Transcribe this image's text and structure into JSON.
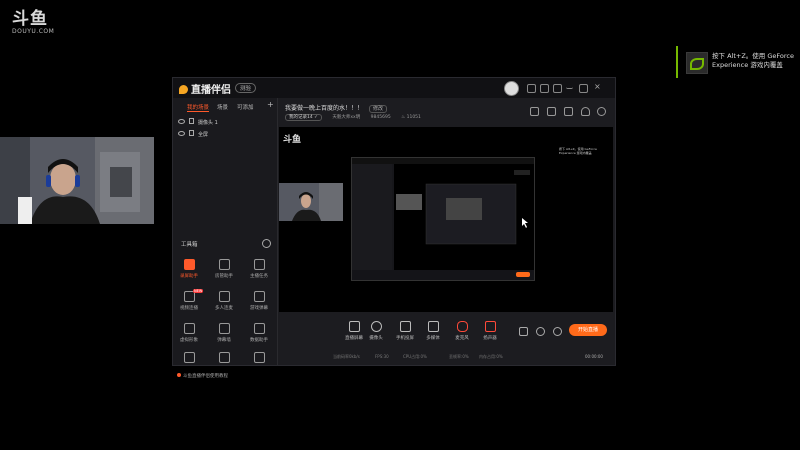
{
  "watermark": {
    "logo": "斗鱼",
    "url": "DOUYU.COM"
  },
  "nvidia_toast": {
    "line1": "按下 Alt+Z。使用 GeForce",
    "line2": "Experience 游戏内覆盖",
    "icon": "nvidia-icon"
  },
  "app": {
    "brand": "直播伴侣",
    "version_badge": "测验",
    "scene_tabs": [
      "我的场景",
      "场景",
      "可添加"
    ],
    "sources": [
      "摄像头 1",
      "全屏"
    ],
    "stream_title": "我要做一晚上百度的水！！！",
    "edit_label": "修改",
    "meta": {
      "category": "我的记录14 ✓",
      "name": "天魁大师xx明",
      "room": "9845695",
      "fans": "11051"
    },
    "toolbox_title": "工具箱",
    "tools": [
      {
        "label": "录屏助手",
        "hot": true,
        "badge": ""
      },
      {
        "label": "房管助手",
        "hot": false,
        "badge": ""
      },
      {
        "label": "主播任务",
        "hot": false,
        "badge": ""
      },
      {
        "label": "视频连播",
        "hot": false,
        "badge": "NEW"
      },
      {
        "label": "多人连麦",
        "hot": false,
        "badge": ""
      },
      {
        "label": "游戏弹幕",
        "hot": false,
        "badge": ""
      },
      {
        "label": "虚拟形象",
        "hot": false,
        "badge": ""
      },
      {
        "label": "弹幕墙",
        "hot": false,
        "badge": ""
      },
      {
        "label": "数据助手",
        "hot": false,
        "badge": ""
      }
    ],
    "tip": "斗鱼直播伴侣使用教程",
    "controls": [
      "直播屏幕",
      "摄像头",
      "手机投屏",
      "多媒体",
      "麦克风",
      "扬声器"
    ],
    "start_button": "开始直播",
    "status": [
      "当前码率0kb/s",
      "FPS:30",
      "CPU占用:0%",
      "丢帧率:0%",
      "内存占用:0%",
      "00:00:00"
    ],
    "preview_watermark": "斗鱼"
  }
}
